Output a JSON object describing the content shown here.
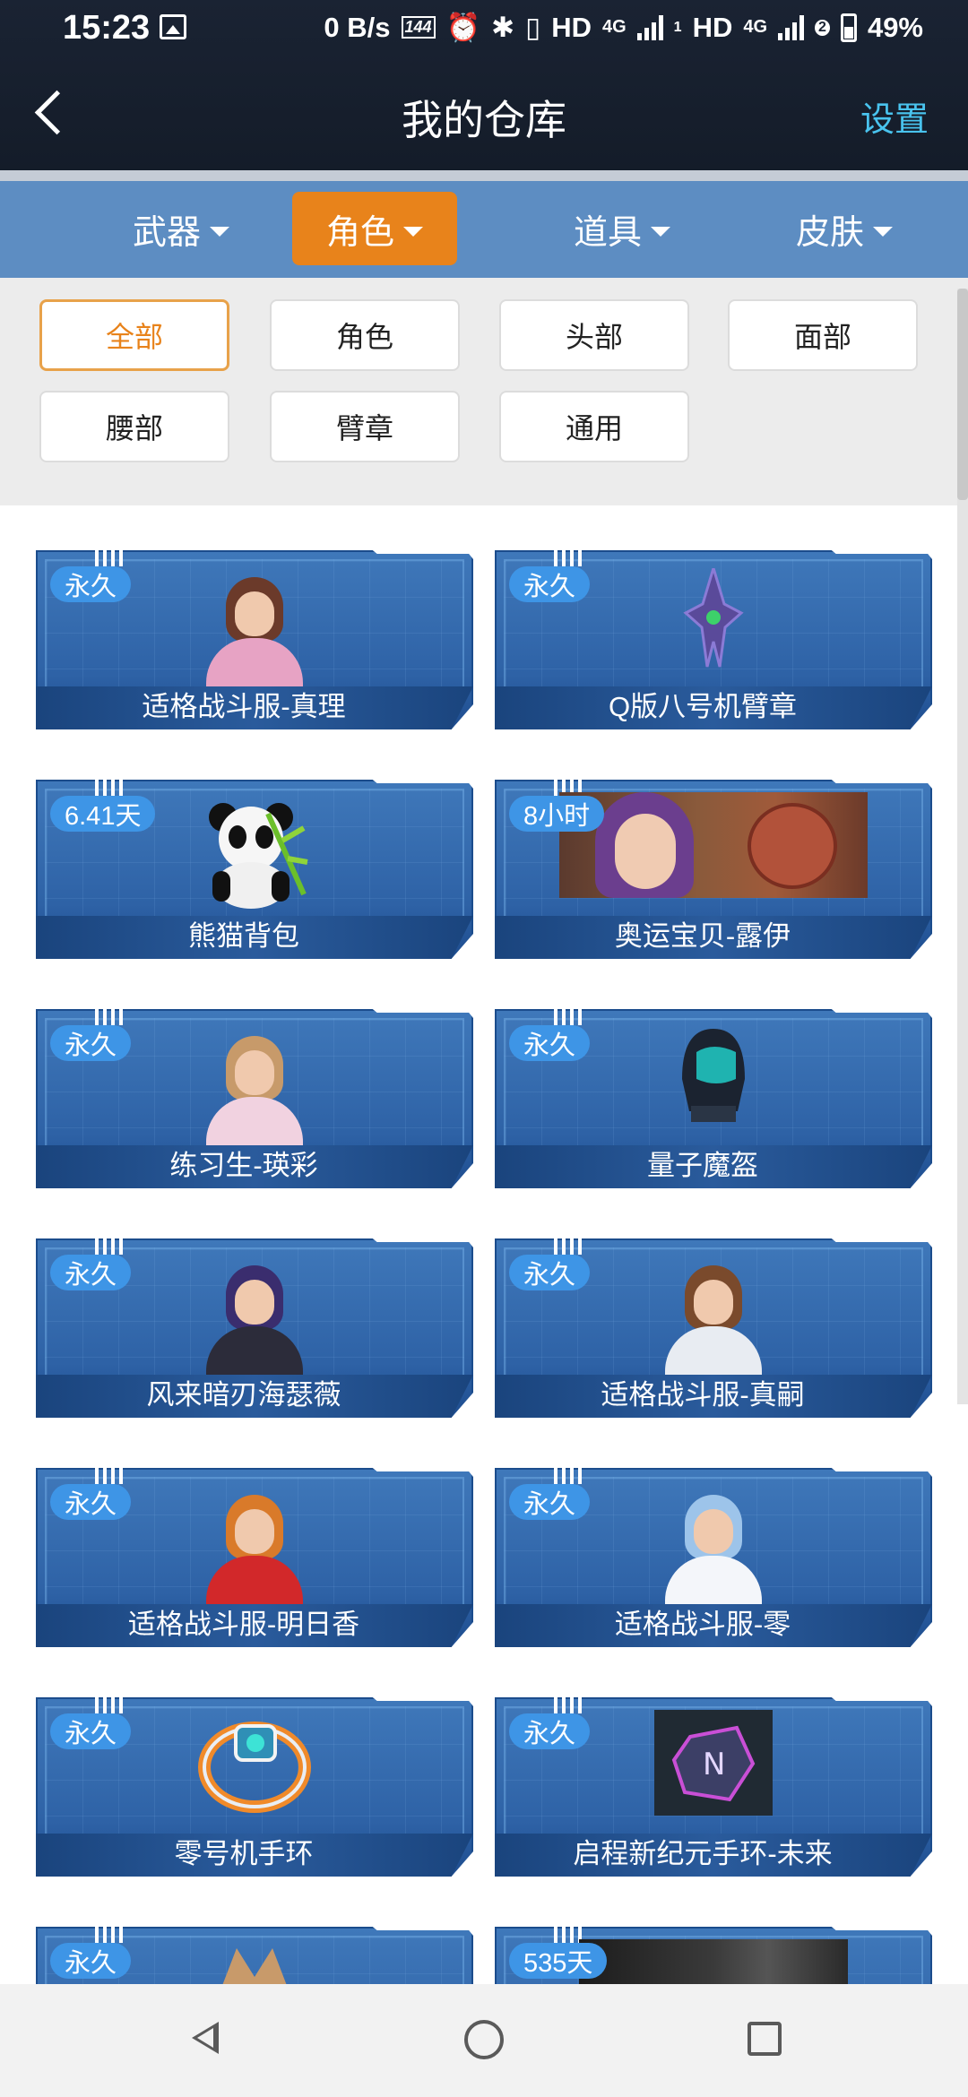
{
  "status_bar": {
    "time": "15:23",
    "net_speed": "0 B/s",
    "refresh": "144",
    "hd1": "HD",
    "g1": "4G",
    "sim1": "1",
    "hd2": "HD",
    "g2": "4G",
    "sim2": "2",
    "battery": "49%"
  },
  "header": {
    "title": "我的仓库",
    "settings_label": "设置"
  },
  "categories": [
    {
      "label": "武器"
    },
    {
      "label": "角色"
    },
    {
      "label": "道具"
    },
    {
      "label": "皮肤"
    }
  ],
  "active_category": "角色",
  "filters": [
    {
      "label": "全部"
    },
    {
      "label": "角色"
    },
    {
      "label": "头部"
    },
    {
      "label": "面部"
    },
    {
      "label": "腰部"
    },
    {
      "label": "臂章"
    },
    {
      "label": "通用"
    }
  ],
  "active_filter": "全部",
  "items": [
    {
      "badge": "永久",
      "name": "适格战斗服-真理"
    },
    {
      "badge": "永久",
      "name": "Q版八号机臂章"
    },
    {
      "badge": "6.41天",
      "name": "熊猫背包"
    },
    {
      "badge": "8小时",
      "name": "奥运宝贝-露伊"
    },
    {
      "badge": "永久",
      "name": "练习生-瑛彩"
    },
    {
      "badge": "永久",
      "name": "量子魔盔"
    },
    {
      "badge": "永久",
      "name": "风来暗刃海瑟薇"
    },
    {
      "badge": "永久",
      "name": "适格战斗服-真嗣"
    },
    {
      "badge": "永久",
      "name": "适格战斗服-明日香"
    },
    {
      "badge": "永久",
      "name": "适格战斗服-零"
    },
    {
      "badge": "永久",
      "name": "零号机手环"
    },
    {
      "badge": "永久",
      "name": "启程新纪元手环-未来"
    },
    {
      "badge": "永久",
      "name": ""
    },
    {
      "badge": "535天",
      "name": ""
    }
  ],
  "colors": {
    "header_bg": "#1a2333",
    "category_bar": "#5d8dc2",
    "active_tab": "#e8831b",
    "settings_link": "#49c3ee",
    "card_blue": "#2e62a6",
    "badge_blue": "#3e95e6"
  }
}
